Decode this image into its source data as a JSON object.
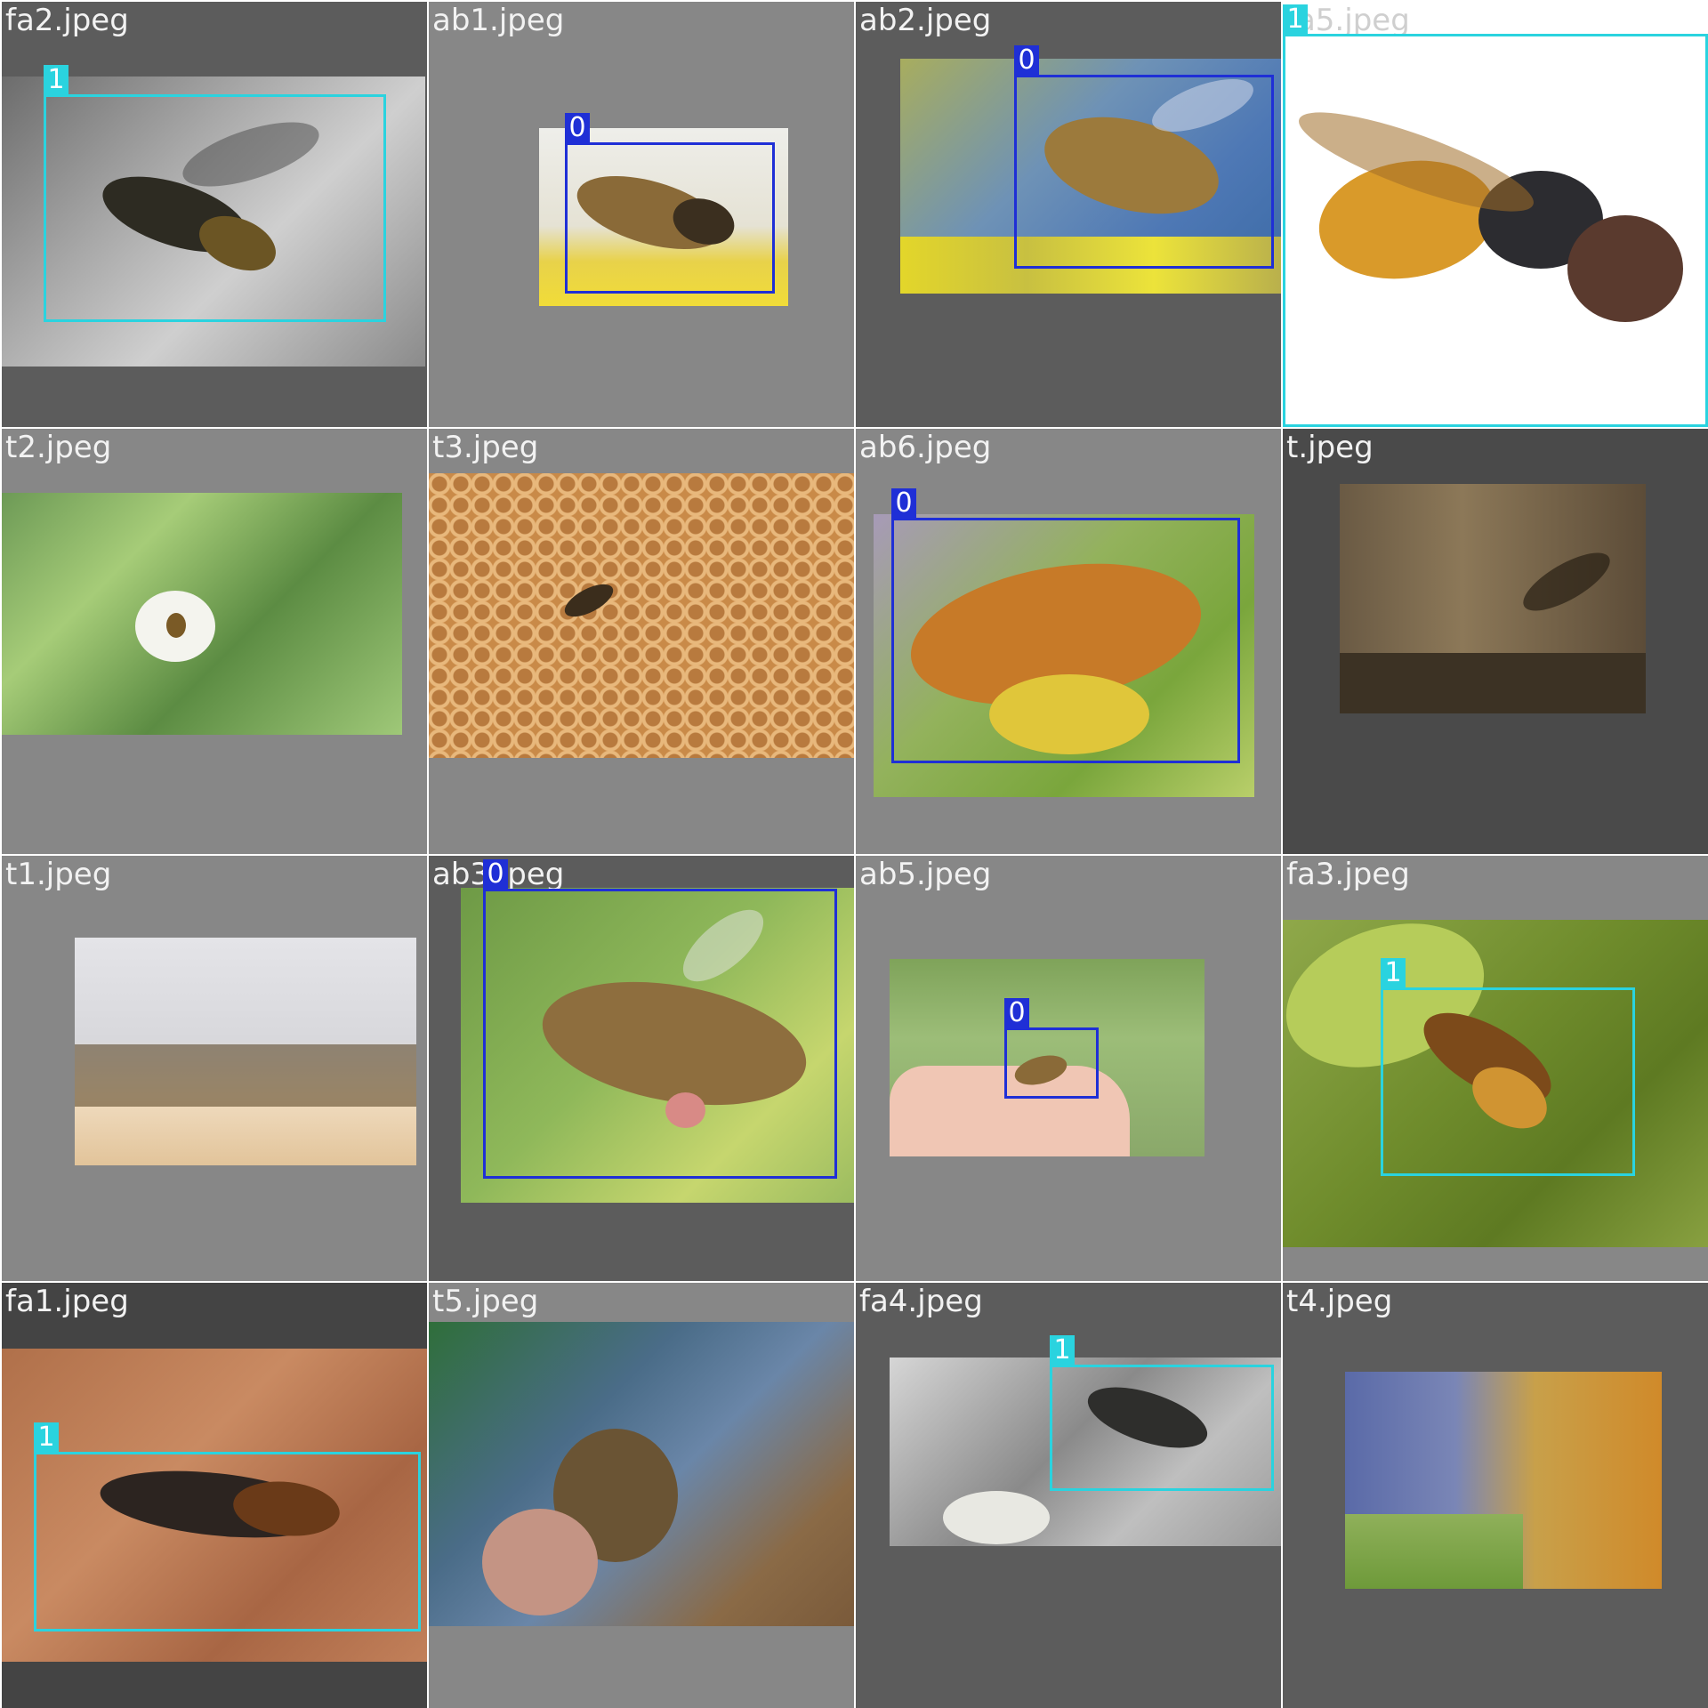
{
  "grid": {
    "tiles": [
      {
        "filename": "fa2.jpeg",
        "detections": [
          {
            "class_label": "1"
          }
        ]
      },
      {
        "filename": "ab1.jpeg",
        "detections": [
          {
            "class_label": "0"
          }
        ]
      },
      {
        "filename": "ab2.jpeg",
        "detections": [
          {
            "class_label": "0"
          }
        ]
      },
      {
        "filename": "fa5.jpeg",
        "detections": [
          {
            "class_label": "1"
          }
        ]
      },
      {
        "filename": "t2.jpeg",
        "detections": []
      },
      {
        "filename": "t3.jpeg",
        "detections": []
      },
      {
        "filename": "ab6.jpeg",
        "detections": [
          {
            "class_label": "0"
          }
        ]
      },
      {
        "filename": "t.jpeg",
        "detections": []
      },
      {
        "filename": "t1.jpeg",
        "detections": []
      },
      {
        "filename": "ab3.jpeg",
        "detections": [
          {
            "class_label": "0"
          }
        ]
      },
      {
        "filename": "ab5.jpeg",
        "detections": [
          {
            "class_label": "0"
          }
        ]
      },
      {
        "filename": "fa3.jpeg",
        "detections": [
          {
            "class_label": "1"
          }
        ]
      },
      {
        "filename": "fa1.jpeg",
        "detections": [
          {
            "class_label": "1"
          }
        ]
      },
      {
        "filename": "t5.jpeg",
        "detections": []
      },
      {
        "filename": "fa4.jpeg",
        "detections": [
          {
            "class_label": "1"
          }
        ]
      },
      {
        "filename": "t4.jpeg",
        "detections": []
      }
    ]
  },
  "colors": {
    "class_0": "#1f2fd6",
    "class_1": "#2ad3df"
  }
}
